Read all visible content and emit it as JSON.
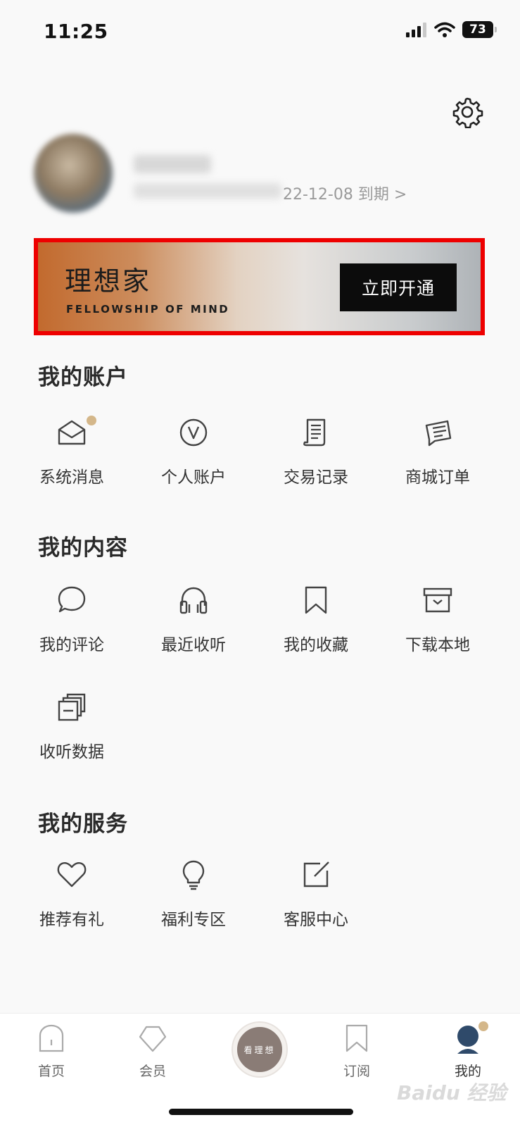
{
  "status_bar": {
    "time": "11:25",
    "battery": "73"
  },
  "header": {
    "expiry_text": "22-12-08 到期 >"
  },
  "banner": {
    "title": "理想家",
    "subtitle": "FELLOWSHIP OF MIND",
    "button_label": "立即开通"
  },
  "sections": [
    {
      "title": "我的账户",
      "items": [
        {
          "label": "系统消息",
          "icon": "envelope-icon"
        },
        {
          "label": "个人账户",
          "icon": "v-circle-icon"
        },
        {
          "label": "交易记录",
          "icon": "receipt-icon"
        },
        {
          "label": "商城订单",
          "icon": "order-list-icon"
        }
      ]
    },
    {
      "title": "我的内容",
      "items": [
        {
          "label": "我的评论",
          "icon": "speech-bubble-icon"
        },
        {
          "label": "最近收听",
          "icon": "headphones-icon"
        },
        {
          "label": "我的收藏",
          "icon": "bookmark-icon"
        },
        {
          "label": "下载本地",
          "icon": "archive-box-icon"
        },
        {
          "label": "收听数据",
          "icon": "stacked-cards-icon"
        }
      ]
    },
    {
      "title": "我的服务",
      "items": [
        {
          "label": "推荐有礼",
          "icon": "heart-icon"
        },
        {
          "label": "福利专区",
          "icon": "lightbulb-icon"
        },
        {
          "label": "客服中心",
          "icon": "edit-icon"
        }
      ]
    }
  ],
  "tab_bar": {
    "tabs": [
      {
        "label": "首页",
        "icon": "home-icon"
      },
      {
        "label": "会员",
        "icon": "pentagon-icon"
      },
      {
        "label": "看理想",
        "icon": "center-logo"
      },
      {
        "label": "订阅",
        "icon": "bookmark-icon"
      },
      {
        "label": "我的",
        "icon": "user-avatar-icon"
      }
    ]
  },
  "watermark": "Baidu 经验"
}
